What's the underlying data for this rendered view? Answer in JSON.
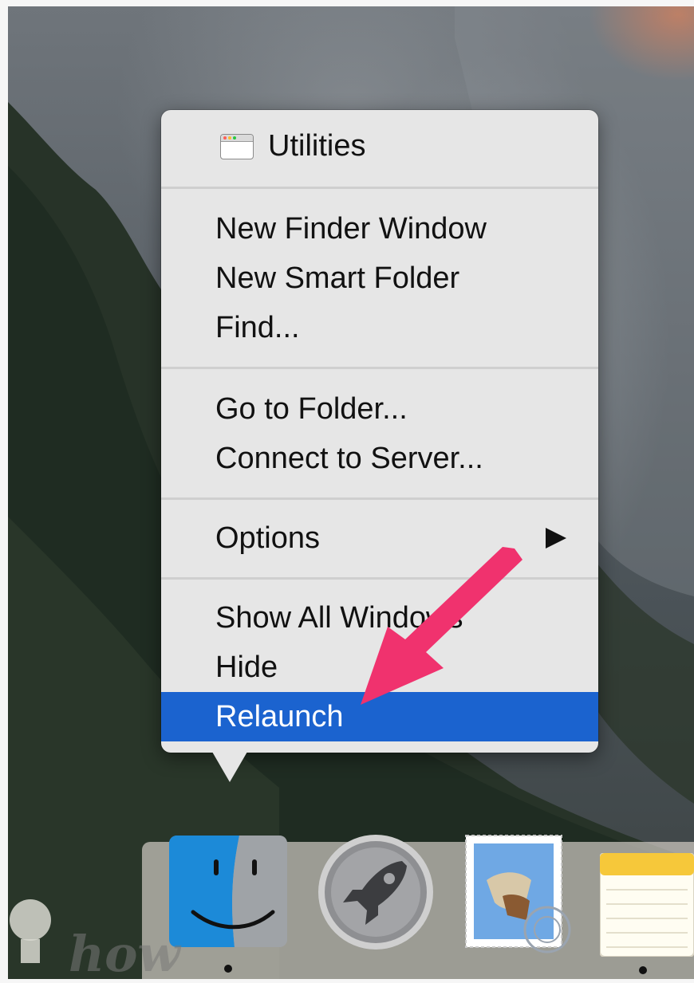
{
  "menu": {
    "title": "Utilities",
    "groups": [
      [
        "New Finder Window",
        "New Smart Folder",
        "Find..."
      ],
      [
        "Go to Folder...",
        "Connect to Server..."
      ],
      [
        "Options"
      ],
      [
        "Show All Windows",
        "Hide",
        "Relaunch"
      ]
    ],
    "selected": "Relaunch",
    "submenu_indicator_on": "Options"
  },
  "dock": {
    "items": [
      "finder-icon",
      "launchpad-icon",
      "mail-icon",
      "notes-icon"
    ],
    "running_indicators": [
      "finder-icon",
      "notes-icon"
    ]
  },
  "annotation": {
    "arrow_color": "#f0326e"
  },
  "watermark_text": "how",
  "colors": {
    "menu_bg": "#e6e6e6",
    "selection": "#1b63cf"
  }
}
